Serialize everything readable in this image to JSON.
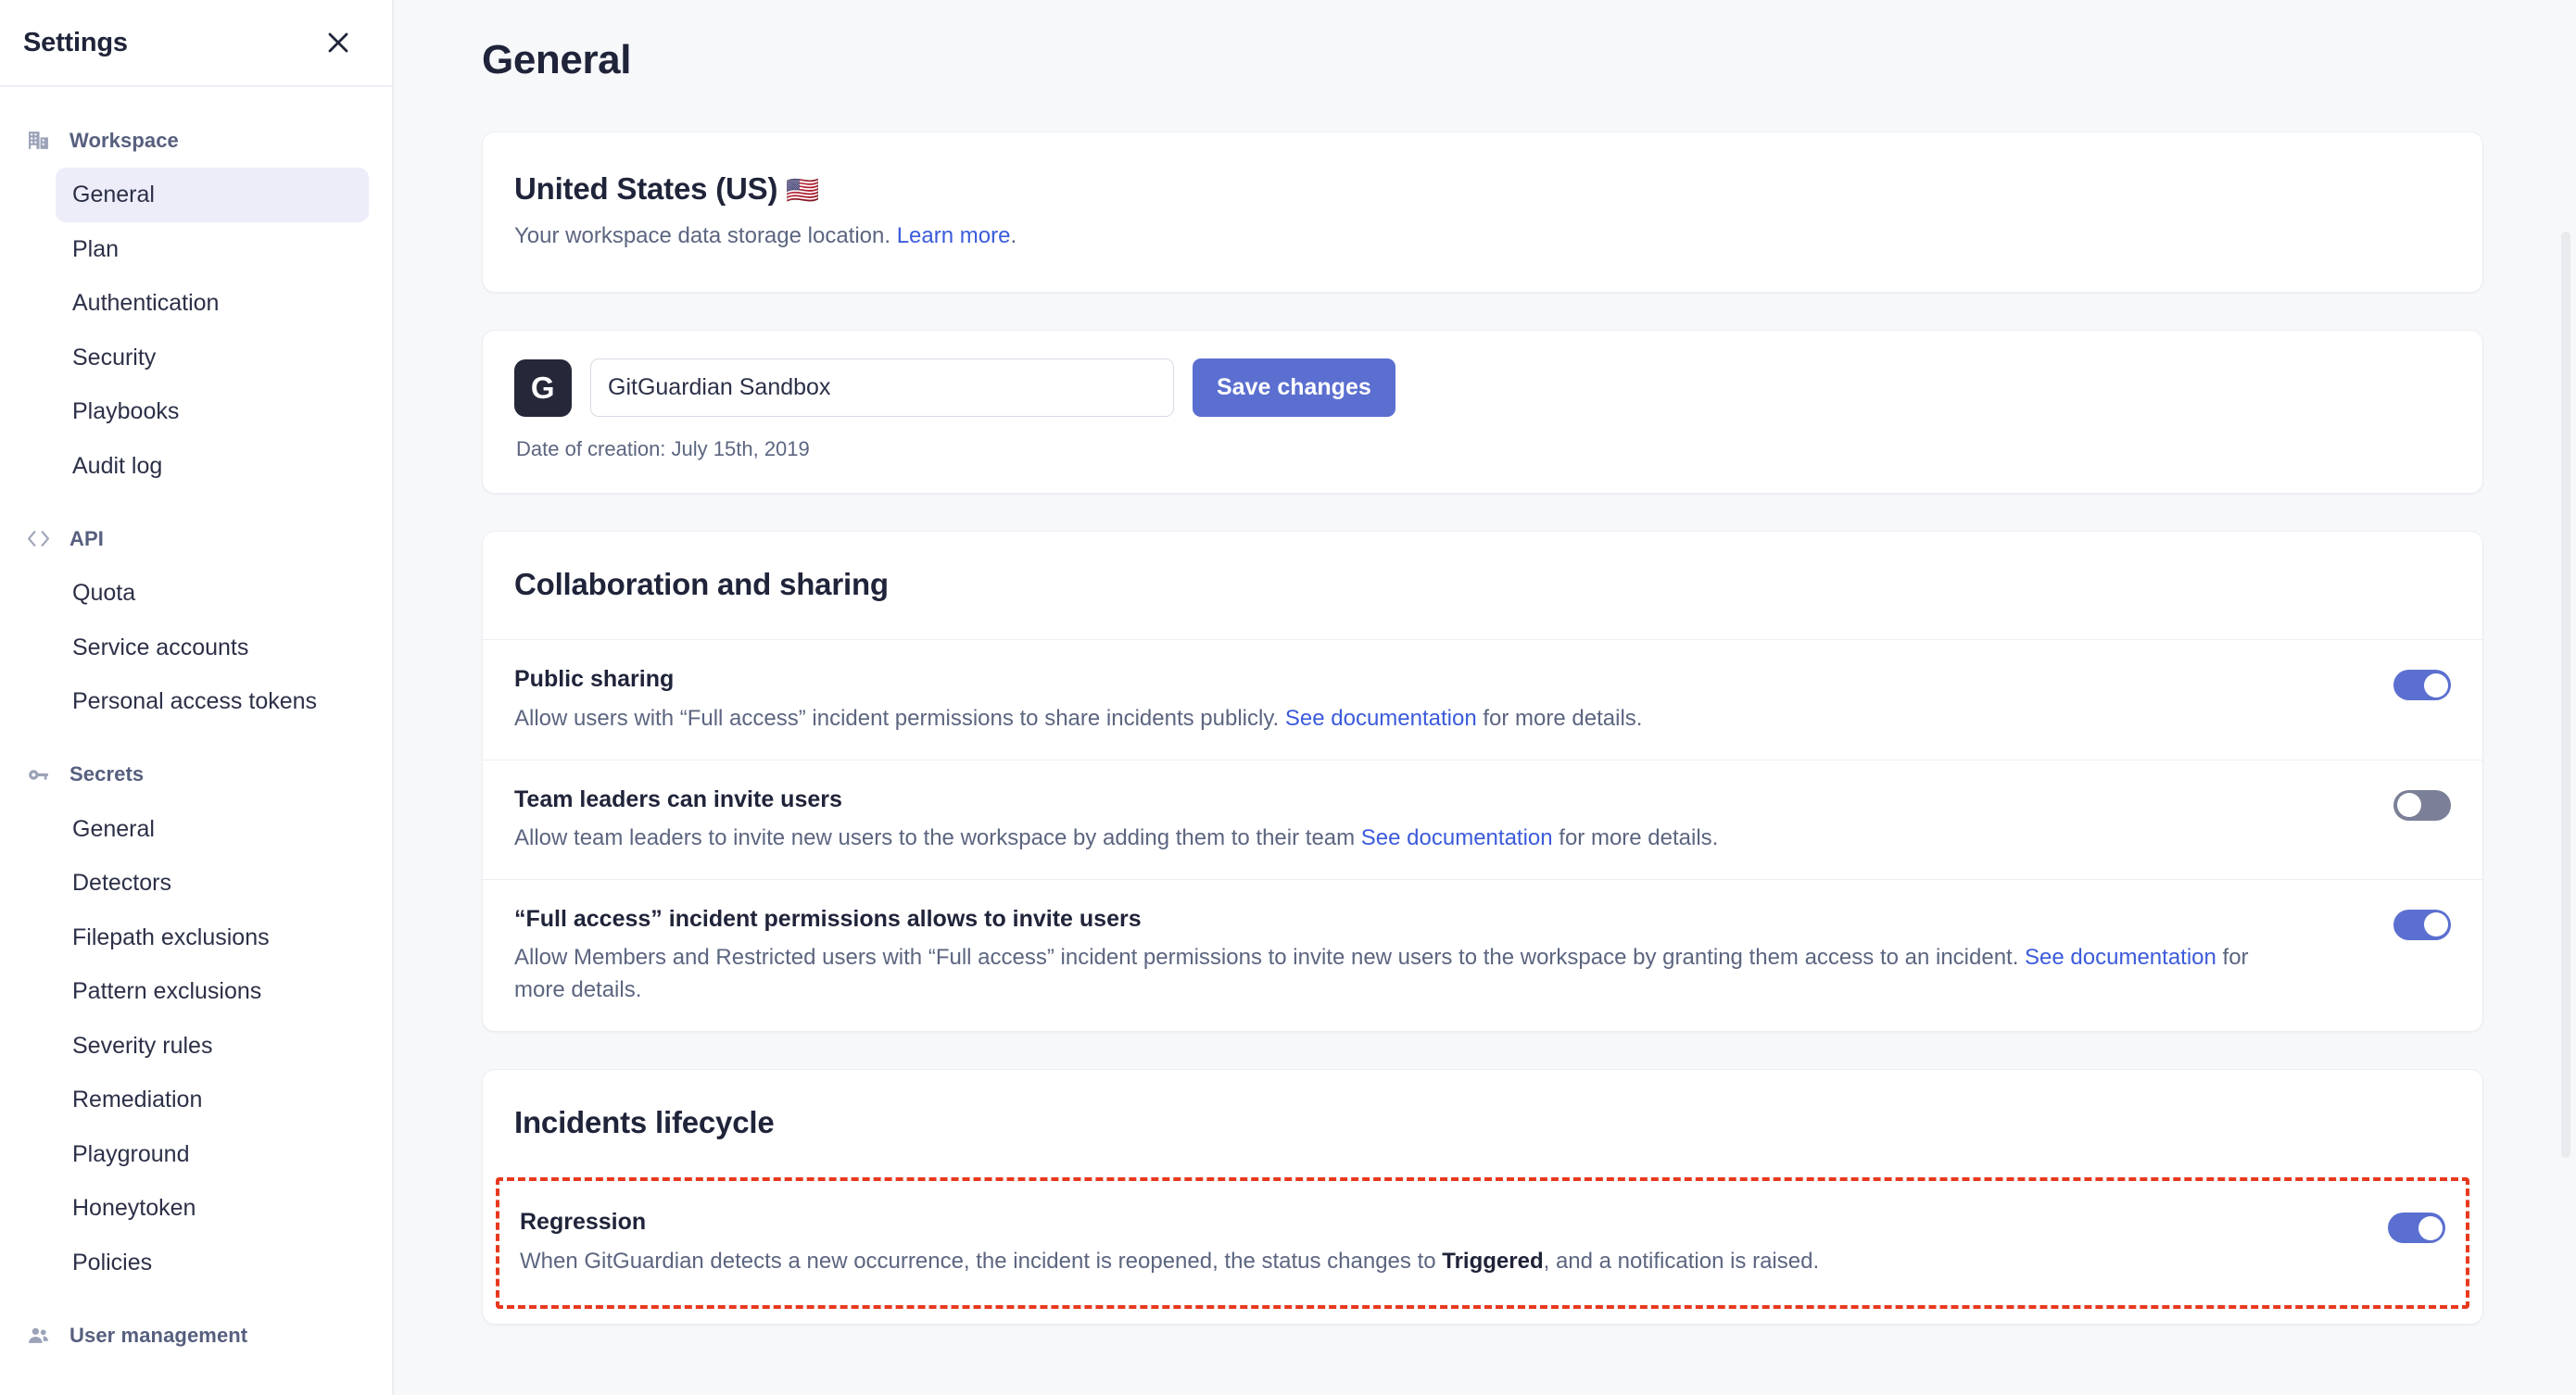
{
  "sidebar": {
    "title": "Settings",
    "close_icon": "close-icon",
    "groups": [
      {
        "label": "Workspace",
        "icon": "building-icon",
        "items": [
          {
            "label": "General",
            "active": true
          },
          {
            "label": "Plan",
            "active": false
          },
          {
            "label": "Authentication",
            "active": false
          },
          {
            "label": "Security",
            "active": false
          },
          {
            "label": "Playbooks",
            "active": false
          },
          {
            "label": "Audit log",
            "active": false
          }
        ]
      },
      {
        "label": "API",
        "icon": "code-brackets-icon",
        "items": [
          {
            "label": "Quota",
            "active": false
          },
          {
            "label": "Service accounts",
            "active": false
          },
          {
            "label": "Personal access tokens",
            "active": false
          }
        ]
      },
      {
        "label": "Secrets",
        "icon": "key-icon",
        "items": [
          {
            "label": "General",
            "active": false
          },
          {
            "label": "Detectors",
            "active": false
          },
          {
            "label": "Filepath exclusions",
            "active": false
          },
          {
            "label": "Pattern exclusions",
            "active": false
          },
          {
            "label": "Severity rules",
            "active": false
          },
          {
            "label": "Remediation",
            "active": false
          },
          {
            "label": "Playground",
            "active": false
          },
          {
            "label": "Honeytoken",
            "active": false
          },
          {
            "label": "Policies",
            "active": false
          }
        ]
      },
      {
        "label": "User management",
        "icon": "users-icon",
        "items": []
      }
    ]
  },
  "main": {
    "page_title": "General",
    "region_card": {
      "title": "United States (US)",
      "flag": "🇺🇸",
      "description_prefix": "Your workspace data storage location. ",
      "link_text": "Learn more",
      "description_suffix": "."
    },
    "workspace_card": {
      "logo_letter": "G",
      "name_value": "GitGuardian Sandbox",
      "name_placeholder": "Workspace name",
      "save_label": "Save changes",
      "creation_date": "Date of creation: July 15th, 2019"
    },
    "collaboration": {
      "title": "Collaboration and sharing",
      "settings": [
        {
          "name": "Public sharing",
          "desc_prefix": "Allow users with “Full access” incident permissions to share incidents publicly. ",
          "link_text": "See documentation",
          "desc_suffix": " for more details.",
          "toggle": "on"
        },
        {
          "name": "Team leaders can invite users",
          "desc_prefix": "Allow team leaders to invite new users to the workspace by adding them to their team ",
          "link_text": "See documentation",
          "desc_suffix": " for more details.",
          "toggle": "off"
        },
        {
          "name": "“Full access” incident permissions allows to invite users",
          "desc_prefix": "Allow Members and Restricted users with “Full access” incident permissions to invite new users to the workspace by granting them access to an incident. ",
          "link_text": "See documentation",
          "desc_suffix": " for more details.",
          "toggle": "on"
        }
      ]
    },
    "incidents_lifecycle": {
      "title": "Incidents lifecycle",
      "regression": {
        "name": "Regression",
        "desc_prefix": "When GitGuardian detects a new occurrence, the incident is reopened, the status changes to ",
        "desc_bold": "Triggered",
        "desc_suffix": ", and a notification is raised.",
        "toggle": "on",
        "highlight_color": "#e8391e"
      }
    }
  },
  "colors": {
    "accent": "#5b6fd0",
    "link": "#3b5bdb",
    "toggle_off": "#7b8098",
    "logo_bg": "#252839",
    "highlight": "#e8391e",
    "page_bg": "#f7f8fa"
  }
}
